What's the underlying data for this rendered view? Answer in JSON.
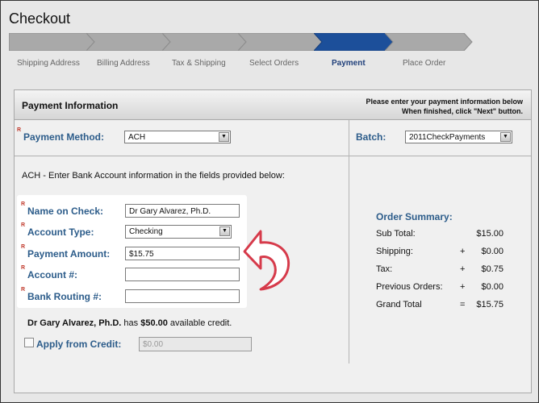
{
  "page": {
    "title": "Checkout"
  },
  "steps": [
    {
      "label": "Shipping Address",
      "active": false
    },
    {
      "label": "Billing Address",
      "active": false
    },
    {
      "label": "Tax & Shipping",
      "active": false
    },
    {
      "label": "Select Orders",
      "active": false
    },
    {
      "label": "Payment",
      "active": true
    },
    {
      "label": "Place Order",
      "active": false
    }
  ],
  "panel": {
    "title": "Payment Information",
    "note_line1": "Please enter your payment information below",
    "note_line2": "When finished, click \"Next\" button."
  },
  "payment_method": {
    "required_mark": "R",
    "label": "Payment Method:",
    "value": "ACH"
  },
  "batch": {
    "label": "Batch:",
    "value": "2011CheckPayments"
  },
  "instructions": "ACH - Enter Bank Account information in the fields provided below:",
  "fields": {
    "name_on_check": {
      "label": "Name on Check:",
      "value": "Dr Gary Alvarez, Ph.D."
    },
    "account_type": {
      "label": "Account Type:",
      "value": "Checking"
    },
    "payment_amount": {
      "label": "Payment Amount:",
      "value": "$15.75"
    },
    "account_number": {
      "label": "Account #:",
      "value": ""
    },
    "routing_number": {
      "label": "Bank Routing #:",
      "value": ""
    }
  },
  "credit": {
    "name": "Dr Gary Alvarez, Ph.D.",
    "text_mid": " has ",
    "amount": "$50.00",
    "text_end": " available credit.",
    "apply_label": "Apply from Credit:",
    "apply_placeholder": "$0.00"
  },
  "summary": {
    "title": "Order Summary:",
    "rows": [
      {
        "label": "Sub Total:",
        "op": "",
        "value": "$15.00"
      },
      {
        "label": "Shipping:",
        "op": "+",
        "value": "$0.00"
      },
      {
        "label": "Tax:",
        "op": "+",
        "value": "$0.75"
      },
      {
        "label": "Previous Orders:",
        "op": "+",
        "value": "$0.00"
      },
      {
        "label": "Grand Total",
        "op": "=",
        "value": "$15.75"
      }
    ]
  },
  "colors": {
    "step_active": "#1c4f9a",
    "step_inactive": "#a9a9a9",
    "label_blue": "#2c5c8a",
    "arrow_fill": "#ffffff",
    "arrow_stroke": "#d63a4a"
  },
  "icons": {
    "dropdown": "chevron-down-icon",
    "callout": "curved-arrow-icon",
    "required": "required-marker-icon"
  }
}
